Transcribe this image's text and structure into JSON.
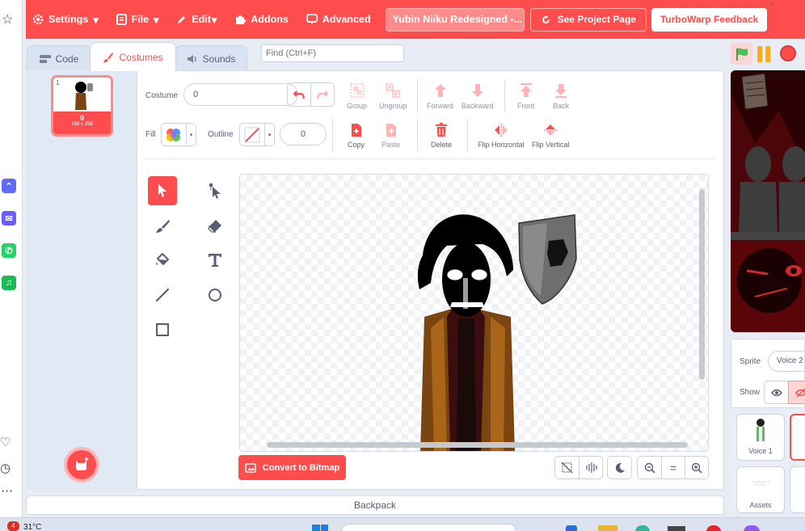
{
  "menubar": {
    "settings": "Settings",
    "file": "File",
    "edit": "Edit",
    "addons": "Addons",
    "advanced": "Advanced",
    "project_title": "Yubin Niiku Redesigned -...",
    "see_project": "See Project Page",
    "feedback": "TurboWarp Feedback"
  },
  "tabs": {
    "code": "Code",
    "costumes": "Costumes",
    "sounds": "Sounds"
  },
  "find": {
    "placeholder": "Find (Ctrl+F)"
  },
  "costume_list": {
    "items": [
      {
        "index": "1",
        "name": "0",
        "size": "156 x 258"
      }
    ]
  },
  "editor": {
    "costume_label": "Costume",
    "costume_name": "0",
    "fill_label": "Fill",
    "outline_label": "Outline",
    "outline_width": "0",
    "group": "Group",
    "ungroup": "Ungroup",
    "forward": "Forward",
    "backward": "Backward",
    "front": "Front",
    "back": "Back",
    "copy": "Copy",
    "paste": "Paste",
    "delete": "Delete",
    "flip_horizontal": "Flip Horizontal",
    "flip_vertical": "Flip Vertical",
    "convert_bitmap": "Convert to Bitmap",
    "zoom_reset": "="
  },
  "sprite_info": {
    "sprite_label": "Sprite",
    "sprite_name": "Voice 2",
    "show_label": "Show"
  },
  "sprites": [
    {
      "name": "Voice 1"
    }
  ],
  "stage_panel": {
    "assets_label": "Assets"
  },
  "backpack": "Backpack",
  "taskbar": {
    "notification_count": "4",
    "temperature": "31°C"
  },
  "colors": {
    "accent": "#ff4c4c",
    "accent_light": "#ffb3b3",
    "flag": "#4cbf56",
    "pause": "#ffab19"
  }
}
